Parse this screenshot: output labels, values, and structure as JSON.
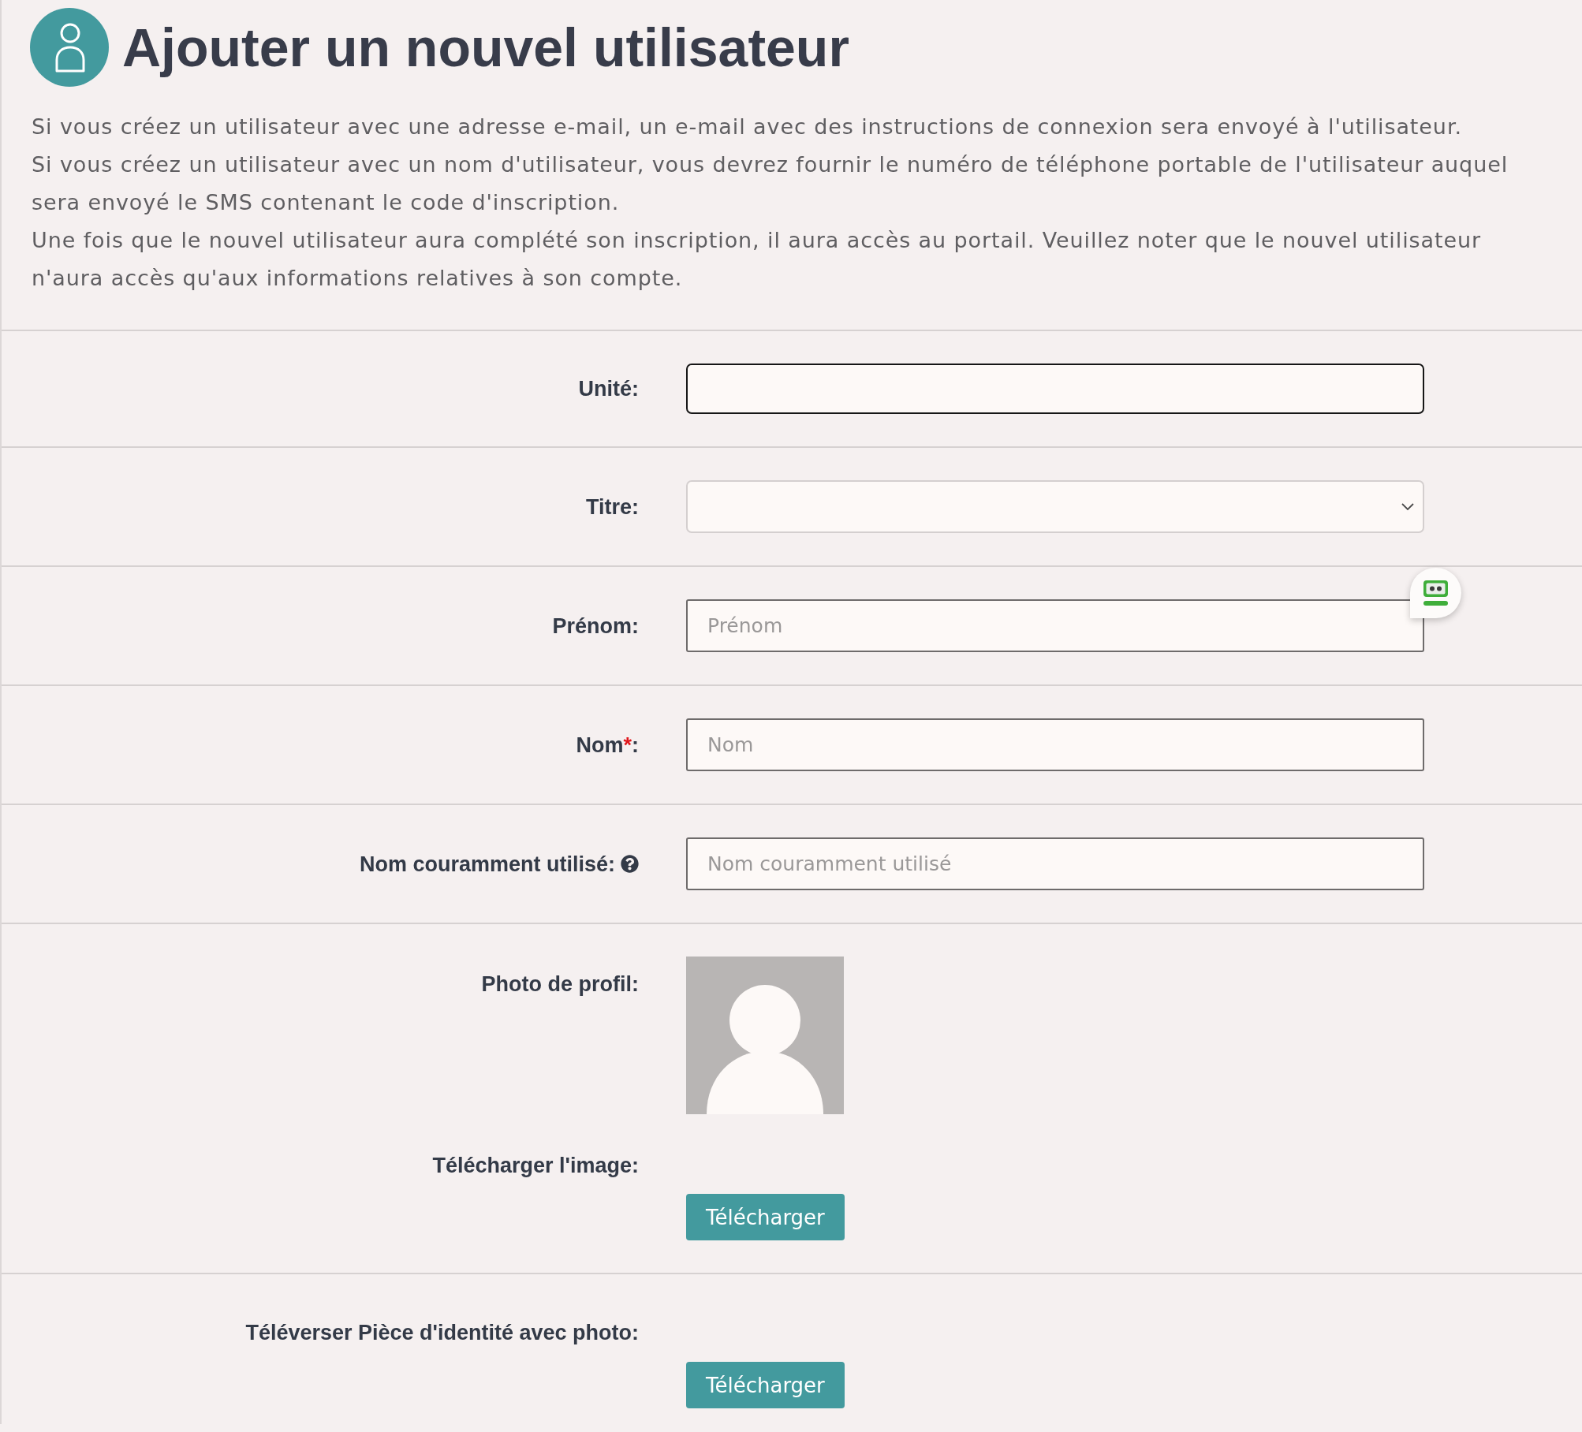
{
  "header": {
    "title": "Ajouter un nouvel utilisateur"
  },
  "intro": [
    "Si vous créez un utilisateur avec une adresse e-mail, un e-mail avec des instructions de connexion sera envoyé à l'utilisateur.",
    "Si vous créez un utilisateur avec un nom d'utilisateur, vous devrez fournir le numéro de téléphone portable de l'utilisateur auquel sera envoyé le SMS contenant le code d'inscription.",
    "Une fois que le nouvel utilisateur aura complété son inscription, il aura accès au portail. Veuillez noter que le nouvel utilisateur n'aura accès qu'aux informations relatives à son compte."
  ],
  "form": {
    "rows": [
      {
        "kind": "text",
        "label": "Unité:",
        "focused": true,
        "help": false,
        "autofill_icon": false
      },
      {
        "kind": "select",
        "label": "Titre:",
        "focused": false
      },
      {
        "kind": "text",
        "label": "Prénom:",
        "placeholder": "Prénom",
        "focused": false,
        "help": false,
        "autofill_icon": true
      },
      {
        "kind": "text",
        "label": "Nom",
        "required_mark": "*",
        "label_suffix": ":",
        "placeholder": "Nom",
        "focused": false,
        "help": false,
        "autofill_icon": false
      },
      {
        "kind": "text",
        "label": "Nom couramment utilisé:",
        "placeholder": "Nom couramment utilisé",
        "focused": false,
        "help": true,
        "autofill_icon": false
      },
      {
        "kind": "photo",
        "label": "Photo de profil:",
        "upload_label": "Télécharger l'image:",
        "button": "Télécharger"
      },
      {
        "kind": "upload",
        "label": "Téléverser Pièce d'identité avec photo:",
        "button": "Télécharger"
      }
    ]
  }
}
